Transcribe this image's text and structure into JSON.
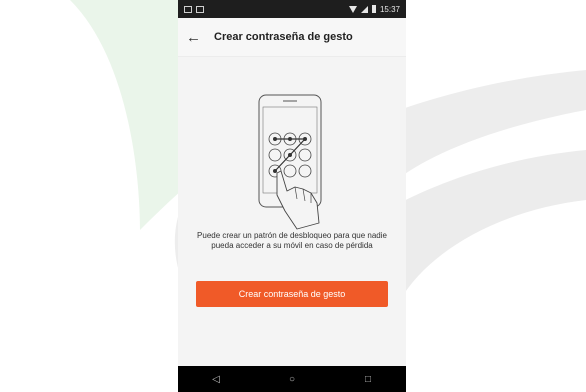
{
  "status_bar": {
    "time": "15:37",
    "icons": [
      "notification-icon",
      "image-icon",
      "wifi-icon",
      "signal-icon",
      "battery-icon"
    ]
  },
  "app_bar": {
    "back_icon": "arrow-left-icon",
    "title": "Crear contraseña de gesto"
  },
  "main": {
    "description": "Puede crear un patrón de desbloqueo para que nadie pueda acceder a su móvil en caso de pérdida",
    "primary_button_label": "Crear contraseña de gesto"
  },
  "nav_bar": {
    "back": "◁",
    "home": "○",
    "recents": "□"
  },
  "colors": {
    "accent": "#f05a28",
    "background_swoosh_green": "#eaf5ea",
    "background_swoosh_gray": "#ededed",
    "status_bar": "#1e1e1e",
    "nav_bar": "#000000"
  }
}
